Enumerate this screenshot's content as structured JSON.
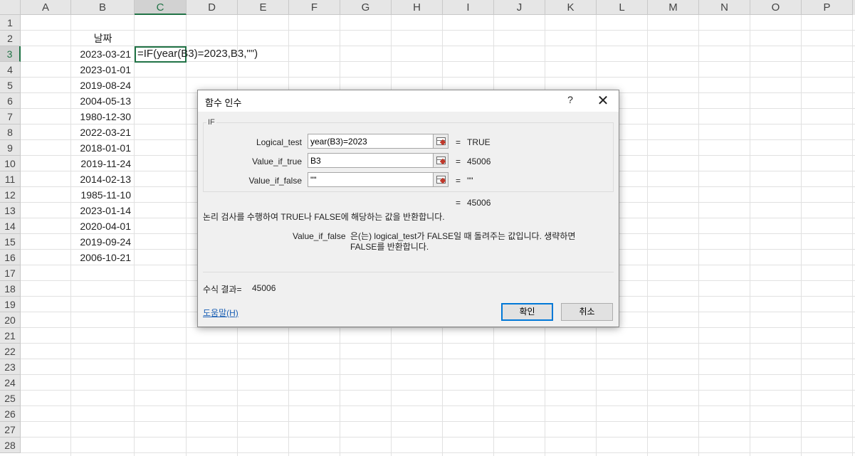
{
  "spreadsheet": {
    "columns": [
      "A",
      "B",
      "C",
      "D",
      "E",
      "F",
      "G",
      "H",
      "I",
      "J",
      "K",
      "L",
      "M",
      "N",
      "O",
      "P"
    ],
    "active_column": "C",
    "active_row": 3,
    "rows": [
      "1",
      "2",
      "3",
      "4",
      "5",
      "6",
      "7",
      "8",
      "9",
      "10",
      "11",
      "12",
      "13",
      "14",
      "15",
      "16",
      "17",
      "18",
      "19",
      "20",
      "21",
      "22",
      "23",
      "24",
      "25",
      "26",
      "27",
      "28"
    ],
    "header_b2": "날짜",
    "dates": [
      "2023-03-21",
      "2023-01-01",
      "2019-08-24",
      "2004-05-13",
      "1980-12-30",
      "2022-03-21",
      "2018-01-01",
      "2019-11-24",
      "2014-02-13",
      "1985-11-10",
      "2023-01-14",
      "2020-04-01",
      "2019-09-24",
      "2006-10-21"
    ],
    "formula_in_cell": "=IF(year(B3)=2023,B3,\"\")"
  },
  "dialog": {
    "title": "함수 인수",
    "help_button": "?",
    "close_button": "✕",
    "function_name": "IF",
    "args": [
      {
        "label": "Logical_test",
        "value": "year(B3)=2023",
        "eq": "=",
        "result": "TRUE"
      },
      {
        "label": "Value_if_true",
        "value": "B3",
        "eq": "=",
        "result": "45006"
      },
      {
        "label": "Value_if_false",
        "value": "\"\"",
        "eq": "=",
        "result": "\"\""
      }
    ],
    "overall_eq": "=",
    "overall_result": "45006",
    "description": "논리 검사를 수행하여 TRUE나 FALSE에 해당하는 값을 반환합니다.",
    "arg_desc_name": "Value_if_false",
    "arg_desc_text": "은(는) logical_test가 FALSE일 때 돌려주는 값입니다. 생략하면 FALSE를 반환합니다.",
    "formula_result_label": "수식 결과=",
    "formula_result_value": "45006",
    "help_link": "도움말(H)",
    "ok_button": "확인",
    "cancel_button": "취소"
  }
}
